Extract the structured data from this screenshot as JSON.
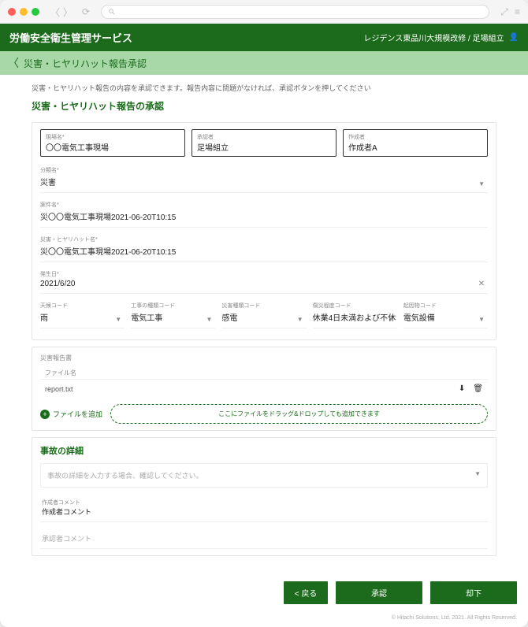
{
  "header": {
    "app_title": "労働安全衛生管理サービス",
    "breadcrumb": "レジデンス東品川大規模改修 / 足場組立",
    "sub_title": "災害・ヒヤリハット報告承認"
  },
  "page": {
    "hint": "災害・ヒヤリハット報告の内容を承認できます。報告内容に問題がなければ、承認ボタンを押してください",
    "title": "災害・ヒヤリハット報告の承認"
  },
  "top": {
    "site_lbl": "現場名*",
    "site_val": "〇〇電気工事現場",
    "reporter_lbl": "承認者",
    "reporter_val": "足場組立",
    "creator_lbl": "作成者",
    "creator_val": "作成者A"
  },
  "fields": {
    "category_lbl": "分類名*",
    "category_val": "災害",
    "name_lbl": "案件名*",
    "name_val": "災〇〇電気工事現場2021-06-20T10:15",
    "hh_lbl": "災害・ヒヤリハット名*",
    "hh_val": "災〇〇電気工事現場2021-06-20T10:15",
    "date_lbl": "発生日*",
    "date_val": "2021/6/20"
  },
  "codes": {
    "weather_lbl": "天候コード",
    "weather_val": "雨",
    "work_lbl": "工事の種類コード",
    "work_val": "電気工事",
    "type_lbl": "災害種類コード",
    "type_val": "感電",
    "severity_lbl": "傷災程度コード",
    "severity_val": "休業4日未満および不休",
    "cause_lbl": "起因物コード",
    "cause_val": "電気設備"
  },
  "files": {
    "section_lbl": "災害報告書",
    "col_lbl": "ファイル名",
    "file_name": "report.txt",
    "add_lbl": "ファイルを追加",
    "drop_lbl": "ここにファイルをドラッグ&ドロップしても追加できます"
  },
  "detail": {
    "title": "事故の詳細",
    "placeholder": "事故の詳細を入力する場合、確認してください。"
  },
  "comments": {
    "creator_lbl": "作成者コメント",
    "creator_val": "作成者コメント",
    "approver_lbl": "",
    "approver_ph": "承認者コメント"
  },
  "buttons": {
    "back": "戻る",
    "approve": "承認",
    "reject": "却下"
  },
  "copyright": "© Hitachi Solutions, Ltd. 2021. All Rights Reserved."
}
